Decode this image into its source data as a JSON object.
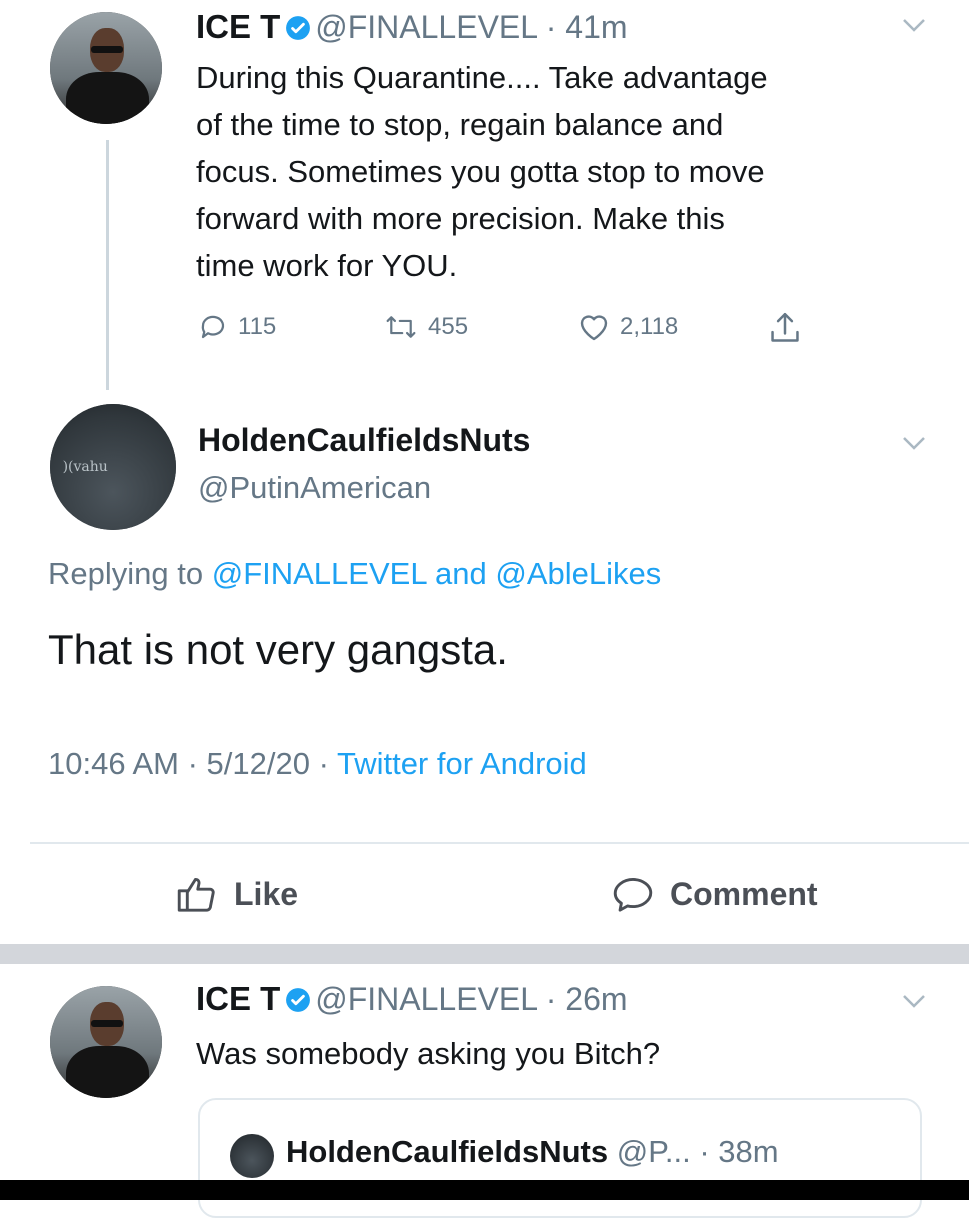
{
  "tweet1": {
    "name": "ICE T",
    "handle": "@FINALLEVEL",
    "time": "41m",
    "text_lines": [
      "During this Quarantine.... Take advantage",
      "of the time to stop, regain balance and",
      "focus. Sometimes you gotta stop to move",
      "forward with more precision. Make this",
      "time work for YOU."
    ],
    "replies": "115",
    "retweets": "455",
    "likes": "2,118"
  },
  "reply": {
    "name": "HoldenCaulfieldsNuts",
    "handle": "@PutinAmerican",
    "replying_prefix": "Replying to",
    "replying_user1": "@FINALLEVEL",
    "replying_and": "and",
    "replying_user2": "@AbleLikes",
    "text": "That is not very gangsta.",
    "timestamp": "10:46 AM · 5/12/20 ·",
    "source": "Twitter for Android"
  },
  "facebook_bar": {
    "like_label": "Like",
    "comment_label": "Comment"
  },
  "tweet2": {
    "name": "ICE T",
    "handle": "@FINALLEVEL",
    "time": "26m",
    "text": "Was somebody asking you Bitch?",
    "quoted": {
      "name": "HoldenCaulfieldsNuts",
      "handle": "@P...",
      "time": "· 38m"
    }
  },
  "icons": {
    "verified": "verified-badge-icon",
    "reply": "reply-bubble-icon",
    "retweet": "retweet-icon",
    "like": "heart-icon",
    "share": "share-icon",
    "chevron": "chevron-down-icon",
    "thumbs_up": "thumbs-up-icon",
    "comment": "comment-bubble-icon"
  },
  "colors": {
    "twitter_blue": "#1da1f2",
    "gray_text": "#657786",
    "facebook_gray": "#4b4f56",
    "separator": "#d3d6db"
  }
}
